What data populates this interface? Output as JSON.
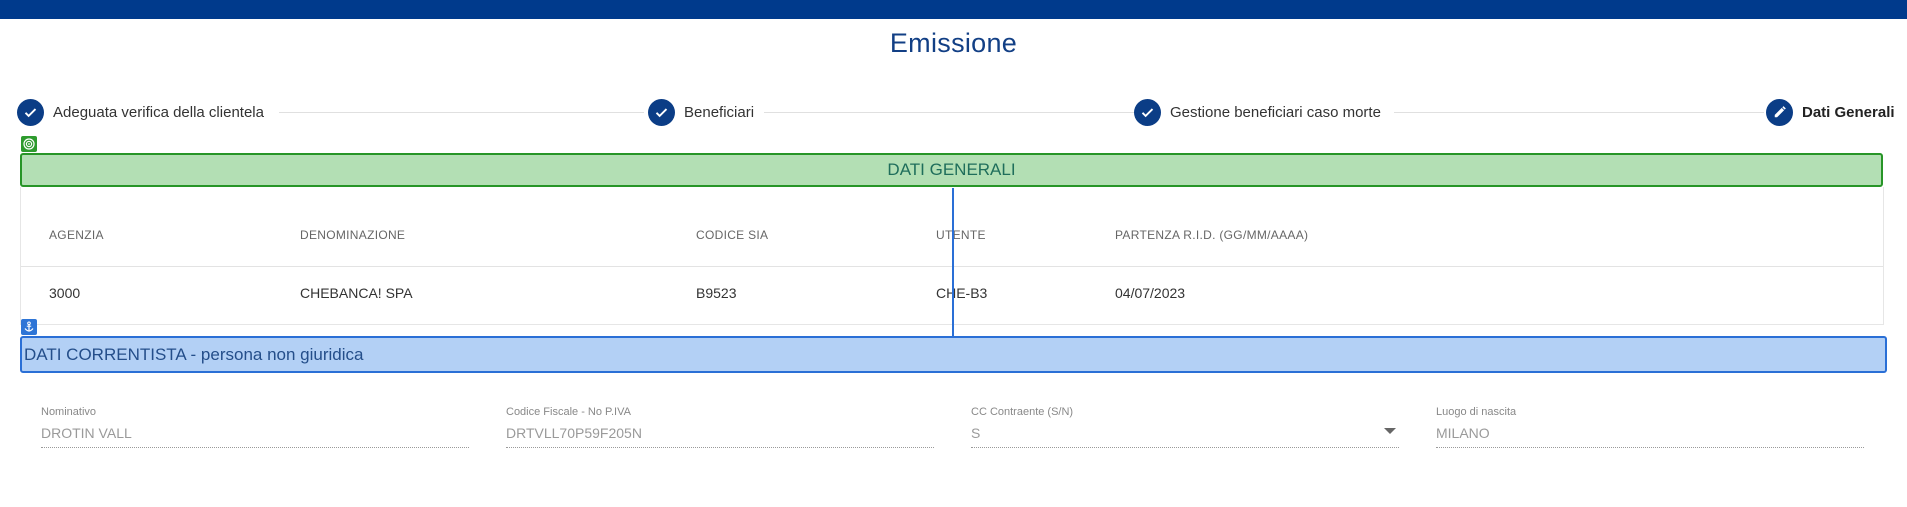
{
  "page": {
    "title": "Emissione"
  },
  "stepper": {
    "steps": [
      {
        "label": "Adeguata verifica della clientela",
        "state": "completed"
      },
      {
        "label": "Beneficiari",
        "state": "completed"
      },
      {
        "label": "Gestione beneficiari caso morte",
        "state": "completed"
      },
      {
        "label": "Dati Generali",
        "state": "editing"
      }
    ]
  },
  "dati_generali": {
    "banner": "DATI GENERALI",
    "columns": [
      "AGENZIA",
      "DENOMINAZIONE",
      "CODICE SIA",
      "UTENTE",
      "PARTENZA R.I.D. (GG/MM/AAAA)"
    ],
    "row": [
      "3000",
      "CHEBANCA! SPA",
      "B9523",
      "CHE-B3",
      "04/07/2023"
    ]
  },
  "dati_correntista": {
    "banner": "DATI CORRENTISTA - persona non giuridica",
    "fields": [
      {
        "label": "Nominativo",
        "value": "DROTIN VALL"
      },
      {
        "label": "Codice Fiscale - No P.IVA",
        "value": "DRTVLL70P59F205N"
      },
      {
        "label": "CC Contraente (S/N)",
        "value": "S"
      },
      {
        "label": "Luogo di nascita",
        "value": "MILANO"
      }
    ]
  },
  "colors": {
    "brand_blue": "#003a8c",
    "green_banner": "#b3dfb4",
    "blue_banner": "#b3d0f5"
  },
  "icons": [
    "check-icon",
    "pencil-icon",
    "target-icon",
    "anchor-icon",
    "chevron-down-icon"
  ]
}
